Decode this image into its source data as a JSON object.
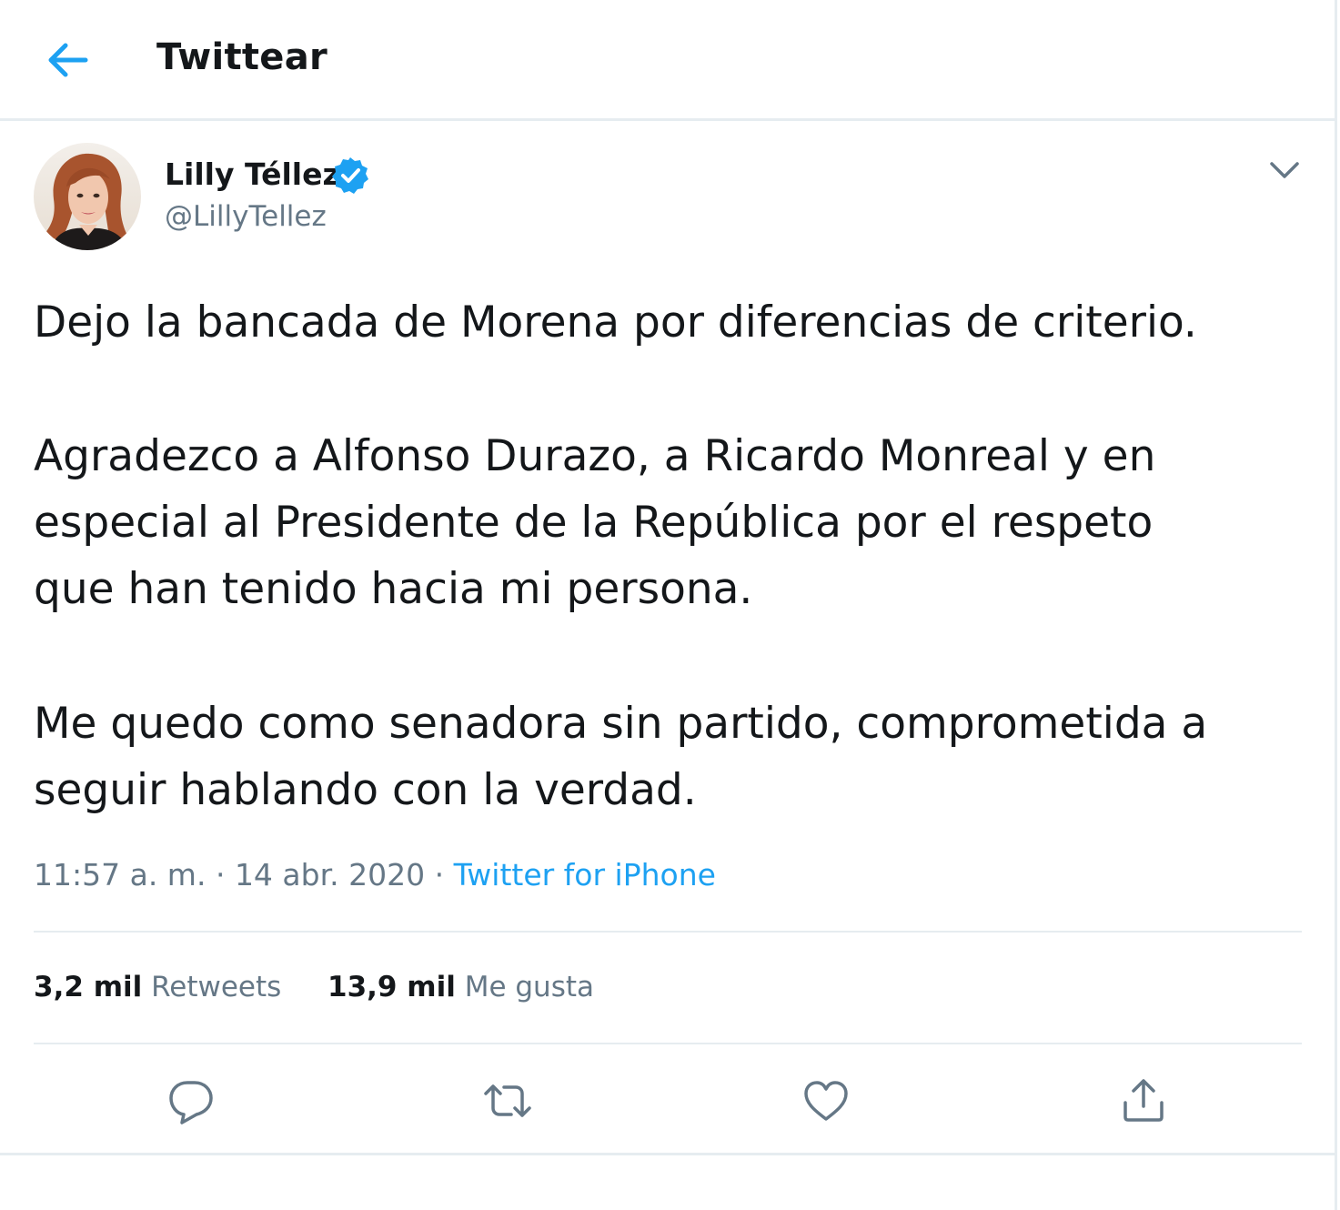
{
  "header": {
    "title": "Twittear",
    "back_icon": "arrow-left-icon"
  },
  "author": {
    "name": "Lilly Téllez",
    "handle": "@LillyTellez",
    "verified_icon": "verified-badge-icon",
    "menu_icon": "chevron-down-icon"
  },
  "tweet": {
    "lines": [
      "Dejo la bancada de Morena por diferencias de criterio.",
      "Agradezco a Alfonso Durazo, a Ricardo Monreal y en",
      "especial al Presidente de la República por el respeto",
      "que han tenido hacia mi persona.",
      "Me quedo como senadora sin partido, comprometida a",
      "seguir hablando con la verdad."
    ],
    "time": "11:57 a. m.",
    "separator": "·",
    "date": "14 abr. 2020",
    "source": "Twitter for iPhone"
  },
  "stats": {
    "retweets_count": "3,2 mil",
    "retweets_label": "Retweets",
    "likes_count": "13,9 mil",
    "likes_label": "Me gusta"
  },
  "actions": [
    {
      "name": "reply",
      "icon": "reply-icon"
    },
    {
      "name": "retweet",
      "icon": "retweet-icon"
    },
    {
      "name": "like",
      "icon": "heart-icon"
    },
    {
      "name": "share",
      "icon": "share-icon"
    }
  ],
  "colors": {
    "accent": "#1da1f2",
    "verified": "#1da1f2",
    "text": "#14171a",
    "secondary": "#657786",
    "border": "#e6ecf0"
  }
}
